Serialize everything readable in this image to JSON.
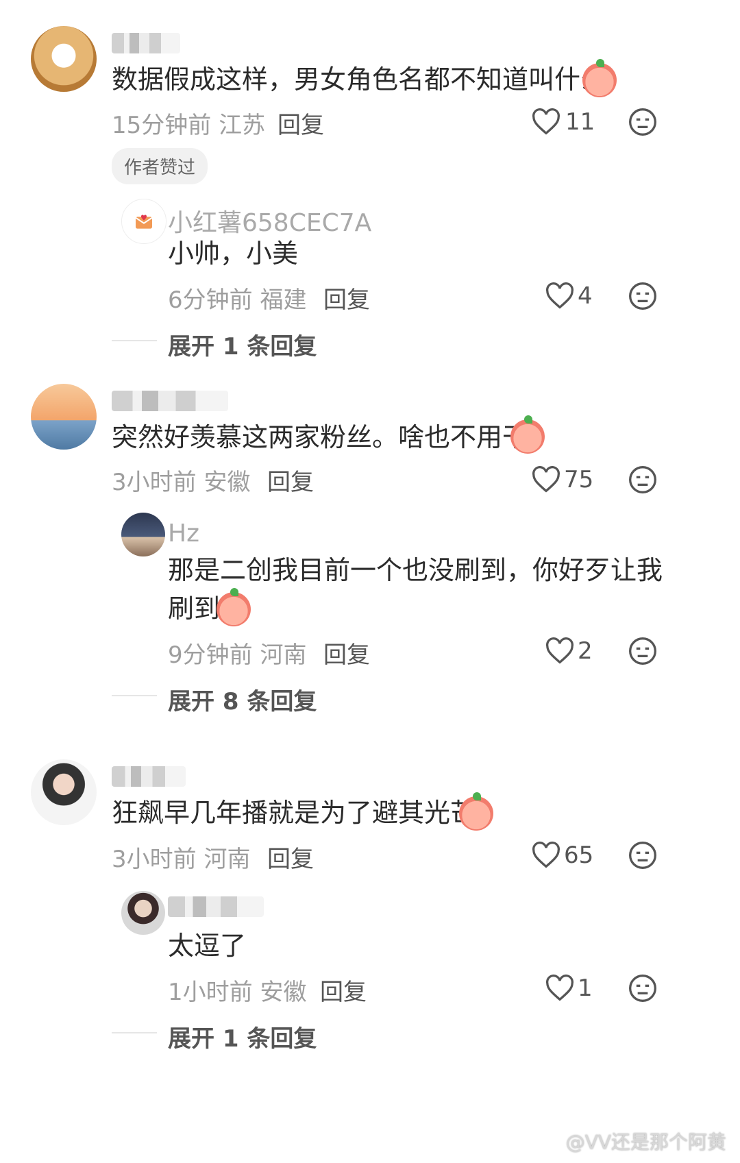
{
  "comments": [
    {
      "name": "",
      "text": "数据假成这样，男女角色名都不知道叫什么",
      "time": "15分钟前",
      "region": "江苏",
      "reply_label": "回复",
      "likes": "11",
      "tag": "作者赞过",
      "replies": [
        {
          "name": "小红薯658CEC7A",
          "text": "小帅，小美",
          "time": "6分钟前",
          "region": "福建",
          "reply_label": "回复",
          "likes": "4"
        }
      ],
      "expand_label": "展开 1 条回复"
    },
    {
      "name": "",
      "text": "突然好羡慕这两家粉丝。啥也不用干",
      "time": "3小时前",
      "region": "安徽",
      "reply_label": "回复",
      "likes": "75",
      "replies": [
        {
          "name": "Hz",
          "text_line1": "那是二创我目前一个也没刷到，你好歹让我",
          "text_line2": "刷到",
          "time": "9分钟前",
          "region": "河南",
          "reply_label": "回复",
          "likes": "2"
        }
      ],
      "expand_label": "展开 8 条回复"
    },
    {
      "name": "",
      "text": "狂飙早几年播就是为了避其光芒",
      "time": "3小时前",
      "region": "河南",
      "reply_label": "回复",
      "likes": "65",
      "replies": [
        {
          "name": "",
          "text": "太逗了",
          "time": "1小时前",
          "region": "安徽",
          "reply_label": "回复",
          "likes": "1"
        }
      ],
      "expand_label": "展开 1 条回复"
    }
  ],
  "icons": {
    "like": "heart-outline-icon",
    "neutral": "neutral-face-icon",
    "emoji": "crying-emoji-icon"
  },
  "watermark": "@VV还是那个阿黄"
}
